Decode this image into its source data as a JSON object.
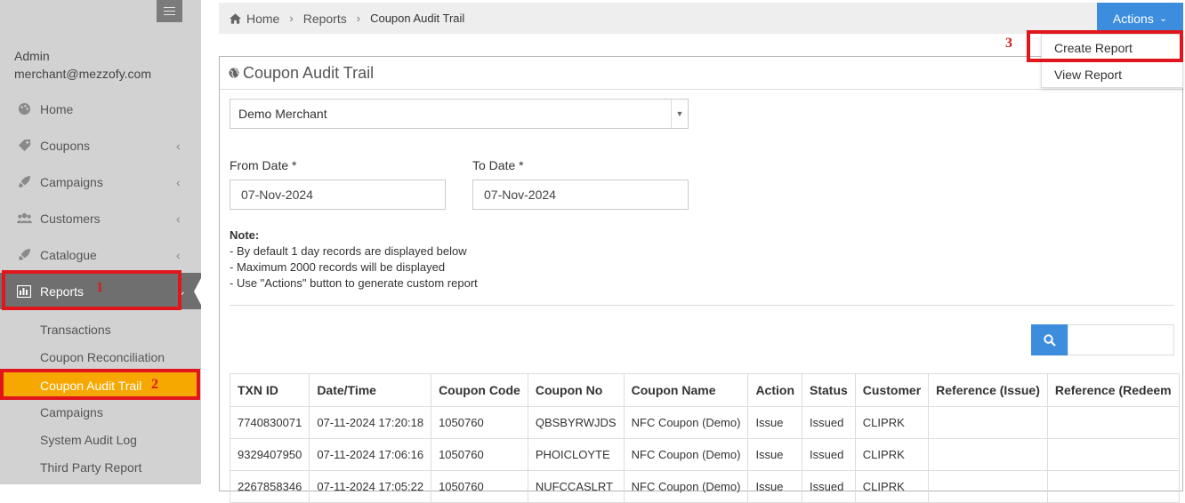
{
  "user": {
    "role": "Admin",
    "email": "merchant@mezzofy.com"
  },
  "sidebar": {
    "items": [
      {
        "label": "Home",
        "icon": "palette-icon"
      },
      {
        "label": "Coupons",
        "icon": "tag-icon"
      },
      {
        "label": "Campaigns",
        "icon": "rocket-icon"
      },
      {
        "label": "Customers",
        "icon": "users-icon"
      },
      {
        "label": "Catalogue",
        "icon": "rocket-icon"
      },
      {
        "label": "Reports",
        "icon": "bar-chart-icon"
      }
    ],
    "submenu": [
      "Transactions",
      "Coupon Reconciliation",
      "Coupon Audit Trail",
      "Campaigns",
      "System Audit Log",
      "Third Party Report"
    ]
  },
  "annotations": {
    "n1": "1",
    "n2": "2",
    "n3": "3"
  },
  "breadcrumb": {
    "home": "Home",
    "reports": "Reports",
    "current": "Coupon Audit Trail"
  },
  "actions": {
    "label": "Actions",
    "menu": [
      "Create Report",
      "View Report"
    ]
  },
  "panel": {
    "title": "Coupon Audit Trail"
  },
  "filters": {
    "merchant": "Demo Merchant",
    "from_label": "From Date *",
    "from_value": "07-Nov-2024",
    "to_label": "To Date *",
    "to_value": "07-Nov-2024"
  },
  "note": {
    "title": "Note:",
    "lines": [
      "- By default 1 day records are displayed below",
      "- Maximum 2000 records will be displayed",
      "- Use \"Actions\" button to generate custom report"
    ]
  },
  "table": {
    "headers": [
      "TXN ID",
      "Date/Time",
      "Coupon Code",
      "Coupon No",
      "Coupon Name",
      "Action",
      "Status",
      "Customer",
      "Reference (Issue)",
      "Reference (Redeem"
    ],
    "rows": [
      [
        "7740830071",
        "07-11-2024 17:20:18",
        "1050760",
        "QBSBYRWJDS",
        "NFC Coupon (Demo)",
        "Issue",
        "Issued",
        "CLIPRK",
        "",
        ""
      ],
      [
        "9329407950",
        "07-11-2024 17:06:16",
        "1050760",
        "PHOICLOYTE",
        "NFC Coupon (Demo)",
        "Issue",
        "Issued",
        "CLIPRK",
        "",
        ""
      ],
      [
        "2267858346",
        "07-11-2024 17:05:22",
        "1050760",
        "NUFCCASLRT",
        "NFC Coupon (Demo)",
        "Issue",
        "Issued",
        "CLIPRK",
        "",
        ""
      ]
    ]
  }
}
